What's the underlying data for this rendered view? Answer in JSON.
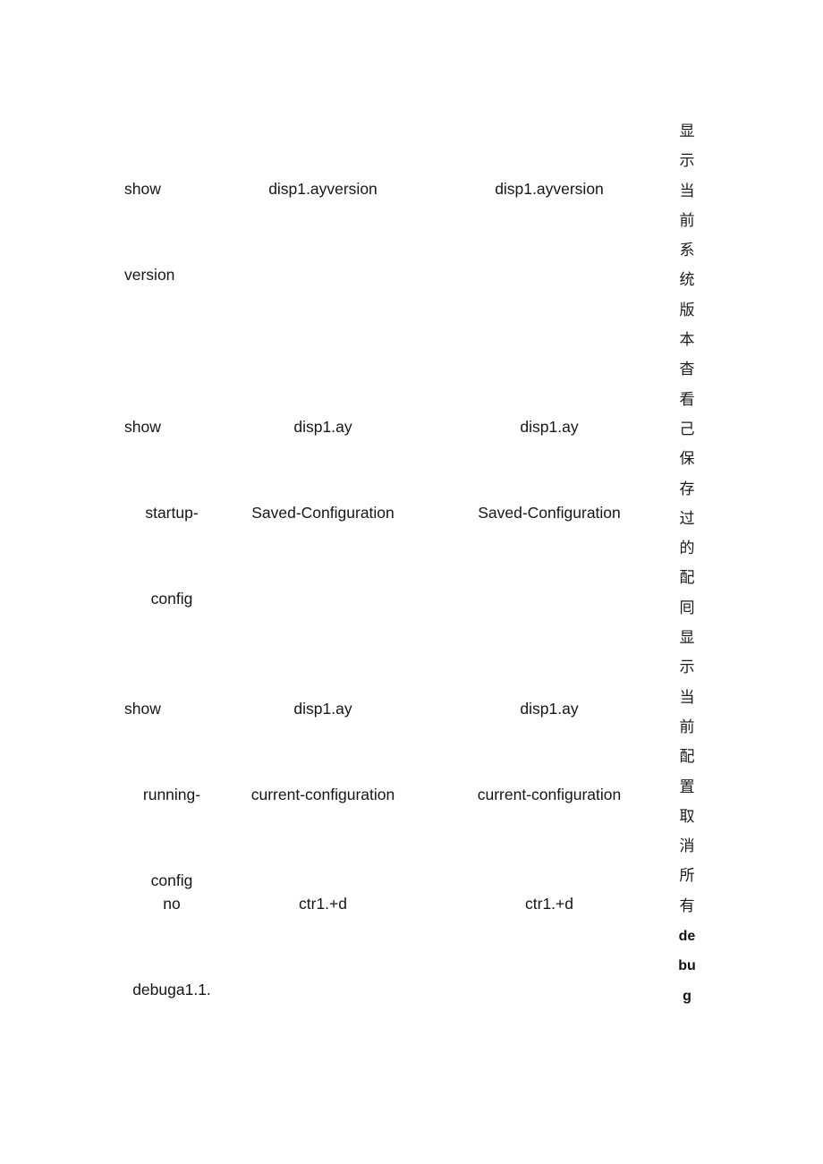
{
  "document": {
    "page_background": "#ffffff",
    "text_color": "#161616",
    "columns": [
      "command",
      "h3c_syntax",
      "huawei_syntax",
      "description_cn"
    ]
  },
  "table": {
    "rows": [
      {
        "command_lines": [
          "show",
          "version"
        ],
        "h3c_lines": [
          "disp1.ayversion"
        ],
        "huawei_lines": [
          "disp1.ayversion"
        ],
        "description": "显示当前系统版本"
      },
      {
        "command_lines": [
          "show",
          "startup-",
          "config"
        ],
        "h3c_lines": [
          "disp1.ay",
          "Saved-Configuration"
        ],
        "huawei_lines": [
          "disp1.ay",
          "Saved-Configuration"
        ],
        "description": "杳看己保存过的配囘"
      },
      {
        "command_lines": [
          "show",
          "running-",
          "config"
        ],
        "h3c_lines": [
          "disp1.ay",
          "current-configuration"
        ],
        "huawei_lines": [
          "disp1.ay",
          "current-configuration"
        ],
        "description": "显示当前配置"
      },
      {
        "command_lines": [
          "no",
          "debuga1.1."
        ],
        "h3c_lines": [
          "ctr1.+d"
        ],
        "huawei_lines": [
          "ctr1.+d"
        ],
        "description": "取消所有"
      }
    ]
  },
  "description_column": {
    "glyphs": [
      {
        "char": "显",
        "latin": false
      },
      {
        "char": "示",
        "latin": false
      },
      {
        "char": "当",
        "latin": false
      },
      {
        "char": "前",
        "latin": false
      },
      {
        "char": "系",
        "latin": false
      },
      {
        "char": "统",
        "latin": false
      },
      {
        "char": "版",
        "latin": false
      },
      {
        "char": "本",
        "latin": false
      },
      {
        "char": "杳",
        "latin": false
      },
      {
        "char": "看",
        "latin": false
      },
      {
        "char": "己",
        "latin": false
      },
      {
        "char": "保",
        "latin": false
      },
      {
        "char": "存",
        "latin": false
      },
      {
        "char": "过",
        "latin": false
      },
      {
        "char": "的",
        "latin": false
      },
      {
        "char": "配",
        "latin": false
      },
      {
        "char": "囘",
        "latin": false
      },
      {
        "char": "显",
        "latin": false
      },
      {
        "char": "示",
        "latin": false
      },
      {
        "char": "当",
        "latin": false
      },
      {
        "char": "前",
        "latin": false
      },
      {
        "char": "配",
        "latin": false
      },
      {
        "char": "置",
        "latin": false
      },
      {
        "char": "取",
        "latin": false
      },
      {
        "char": "消",
        "latin": false
      },
      {
        "char": "所",
        "latin": false
      },
      {
        "char": "有",
        "latin": false
      },
      {
        "char": "de",
        "latin": true
      },
      {
        "char": "bu",
        "latin": true
      },
      {
        "char": "g",
        "latin": true
      }
    ]
  },
  "cells": {
    "r1": {
      "cmd_a": "show",
      "cmd_b": "version",
      "h3c_a": "disp1.ayversion",
      "huawei_a": "disp1.ayversion"
    },
    "r2": {
      "cmd_a": "show",
      "cmd_b": "startup-",
      "cmd_c": "config",
      "h3c_a": "disp1.ay",
      "h3c_b": "Saved-Configuration",
      "huawei_a": "disp1.ay",
      "huawei_b": "Saved-Configuration"
    },
    "r3": {
      "cmd_a": "show",
      "cmd_b": "running-",
      "cmd_c": "config",
      "h3c_a": "disp1.ay",
      "h3c_b": "current-configuration",
      "huawei_a": "disp1.ay",
      "huawei_b": "current-configuration"
    },
    "r4": {
      "cmd_a": "no",
      "cmd_b": "debuga1.1.",
      "h3c_a": "ctr1.+d",
      "huawei_a": "ctr1.+d"
    }
  }
}
